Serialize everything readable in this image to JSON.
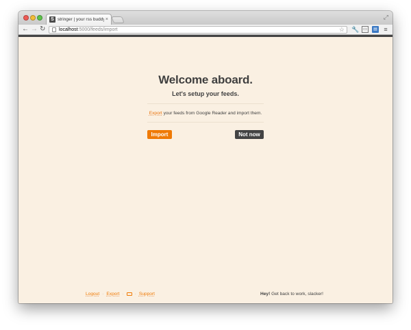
{
  "browser": {
    "tab_title": "stringer | your rss buddy",
    "tab_close": "×",
    "favicon_letter": "S",
    "url_host": "localhost",
    "url_path": ":5000/feeds/import",
    "icons": [
      "back-arrow-icon",
      "forward-arrow-icon",
      "reload-icon",
      "page-icon",
      "star-icon",
      "wrench-icon",
      "extension-icon",
      "bookmark-extension-icon",
      "menu-icon",
      "fullscreen-icon"
    ]
  },
  "page": {
    "title": "Welcome aboard.",
    "subtitle": "Let's setup your feeds.",
    "instruction_link": "Export",
    "instruction_rest": " your feeds from Google Reader and import them.",
    "import_button": "Import",
    "not_now_button": "Not now"
  },
  "footer": {
    "links": [
      "Logout",
      "Export",
      "Support"
    ],
    "separator": "·",
    "message_bold": "Hey!",
    "message_rest": " Get back to work, slacker!"
  },
  "colors": {
    "accent": "#ef7a05",
    "background": "#faf0e2",
    "dark": "#434343",
    "text": "#404040"
  }
}
